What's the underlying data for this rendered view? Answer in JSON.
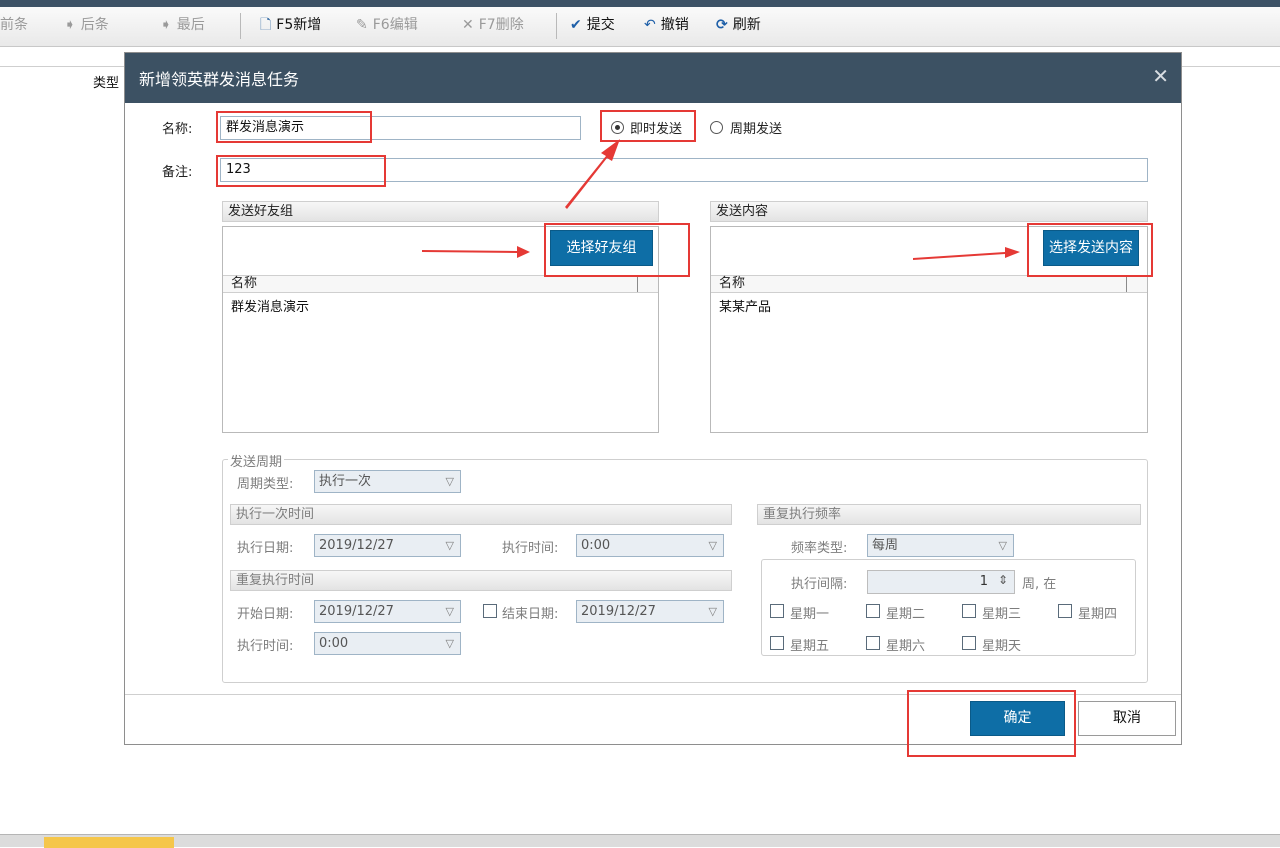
{
  "toolbar": {
    "prev": "前条",
    "next": "后条",
    "last": "最后",
    "add": "F5新增",
    "edit": "F6编辑",
    "delete": "F7删除",
    "submit": "提交",
    "undo": "撤销",
    "refresh": "刷新"
  },
  "background": {
    "type_label": "类型"
  },
  "dialog": {
    "title": "新增领英群发消息任务",
    "name_label": "名称:",
    "name_value": "群发消息演示",
    "send_mode": {
      "immediate": "即时发送",
      "periodic": "周期发送",
      "selected": "immediate"
    },
    "remark_label": "备注:",
    "remark_value": "123",
    "friends": {
      "header": "发送好友组",
      "button": "选择好友组",
      "col_name": "名称",
      "rows": [
        "群发消息演示"
      ]
    },
    "content": {
      "header": "发送内容",
      "button": "选择发送内容",
      "col_name": "名称",
      "rows": [
        "某某产品"
      ]
    },
    "cycle": {
      "group_title": "发送周期",
      "type_label": "周期类型:",
      "type_value": "执行一次",
      "once_header": "执行一次时间",
      "exec_date_label": "执行日期:",
      "exec_date": "2019/12/27",
      "exec_time_label": "执行时间:",
      "exec_time": "0:00",
      "repeat_header": "重复执行时间",
      "start_date_label": "开始日期:",
      "start_date": "2019/12/27",
      "end_date_label": "结束日期:",
      "end_date": "2019/12/27",
      "repeat_time_label": "执行时间:",
      "repeat_time": "0:00",
      "freq_header": "重复执行频率",
      "freq_type_label": "频率类型:",
      "freq_type": "每周",
      "interval_label": "执行间隔:",
      "interval": "1",
      "interval_unit": "周, 在",
      "weekdays": [
        "星期一",
        "星期二",
        "星期三",
        "星期四",
        "星期五",
        "星期六",
        "星期天"
      ]
    },
    "ok": "确定",
    "cancel": "取消"
  },
  "colors": {
    "accent": "#0e6ea6",
    "header": "#3c5163",
    "annotation": "#e53935"
  }
}
